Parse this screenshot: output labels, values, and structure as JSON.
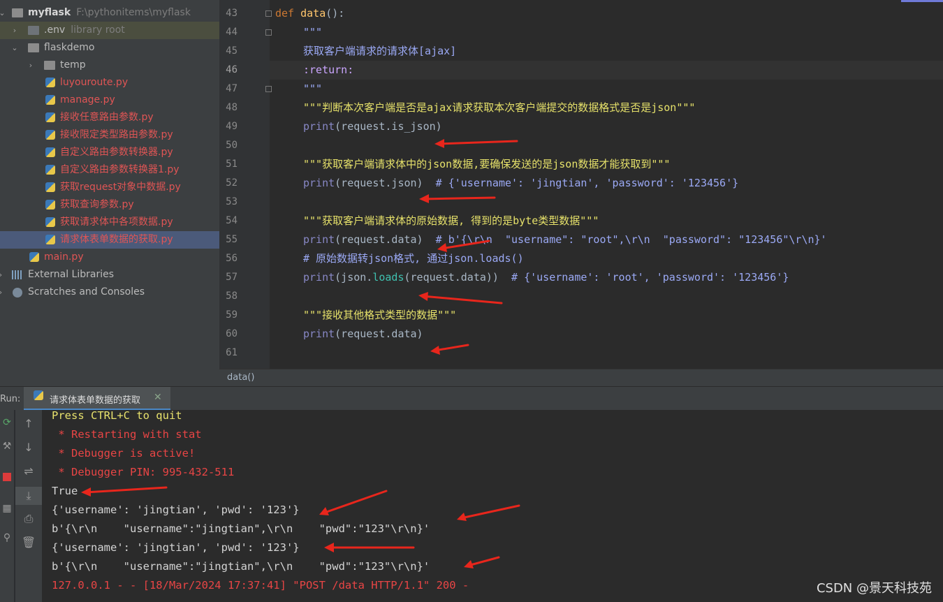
{
  "project": {
    "root": {
      "name": "myflask",
      "path": "F:\\pythonitems\\myflask"
    },
    "items": [
      {
        "label": ".env",
        "suffix": "library root"
      },
      {
        "label": "flaskdemo"
      },
      {
        "label": "temp"
      },
      {
        "label": "luyouroute.py"
      },
      {
        "label": "manage.py"
      },
      {
        "label": "接收任意路由参数.py"
      },
      {
        "label": "接收限定类型路由参数.py"
      },
      {
        "label": "自定义路由参数转换器.py"
      },
      {
        "label": "自定义路由参数转换器1.py"
      },
      {
        "label": "获取request对象中数据.py"
      },
      {
        "label": "获取查询参数.py"
      },
      {
        "label": "获取请求体中各项数据.py"
      },
      {
        "label": "请求体表单数据的获取.py"
      },
      {
        "label": "main.py"
      },
      {
        "label": "External Libraries"
      },
      {
        "label": "Scratches and Consoles"
      }
    ]
  },
  "editor": {
    "line_numbers": [
      "43",
      "44",
      "45",
      "46",
      "47",
      "48",
      "49",
      "50",
      "51",
      "52",
      "53",
      "54",
      "55",
      "56",
      "57",
      "58",
      "59",
      "60",
      "61"
    ],
    "current_line": "46",
    "lines": {
      "l43": {
        "a": "def ",
        "b": "data",
        "c": "():"
      },
      "l44": "\"\"\"",
      "l45": "获取客户端请求的请求体[ajax]",
      "l46": ":return:",
      "l47": "\"\"\"",
      "l48": "\"\"\"判断本次客户端是否是ajax请求获取本次客户端提交的数据格式是否是json\"\"\"",
      "l49": {
        "a": "print",
        "b": "(request.is_json)"
      },
      "l51": "\"\"\"获取客户端请求体中的json数据,要确保发送的是json数据才能获取到\"\"\"",
      "l52": {
        "a": "print",
        "b": "(request.json)  ",
        "c": "# {'username': 'jingtian', 'password': '123456'}"
      },
      "l54": "\"\"\"获取客户端请求体的原始数据, 得到的是byte类型数据\"\"\"",
      "l55": {
        "a": "print",
        "b": "(request.data)  ",
        "c": "# b'{\\r\\n  \"username\": \"root\",\\r\\n  \"password\": \"123456\"\\r\\n}'"
      },
      "l56": "# 原始数据转json格式, 通过json.loads()",
      "l57": {
        "a": "print",
        "b": "(json.",
        "c": "loads",
        "d": "(request.data))  ",
        "e": "# {'username': 'root', 'password': '123456'}"
      },
      "l59": "\"\"\"接收其他格式类型的数据\"\"\"",
      "l60": {
        "a": "print",
        "b": "(request.data)"
      }
    },
    "breadcrumb": "data()"
  },
  "run": {
    "label": "Run:",
    "tab_title": "请求体表单数据的获取",
    "console": [
      "Press CTRL+C to quit",
      " * Restarting with stat",
      " * Debugger is active!",
      " * Debugger PIN: 995-432-511",
      "True",
      "{'username': 'jingtian', 'pwd': '123'}",
      "b'{\\r\\n    \"username\":\"jingtian\",\\r\\n    \"pwd\":\"123\"\\r\\n}'",
      "{'username': 'jingtian', 'pwd': '123'}",
      "b'{\\r\\n    \"username\":\"jingtian\",\\r\\n    \"pwd\":\"123\"\\r\\n}'",
      "127.0.0.1 - - [18/Mar/2024 17:37:41] \"POST /data HTTP/1.1\" 200 -"
    ]
  },
  "watermark": "CSDN @景天科技苑",
  "colors": {
    "accent": "#4a88c7",
    "annotation_arrow": "#e8261c",
    "file_modified": "#e05555"
  }
}
